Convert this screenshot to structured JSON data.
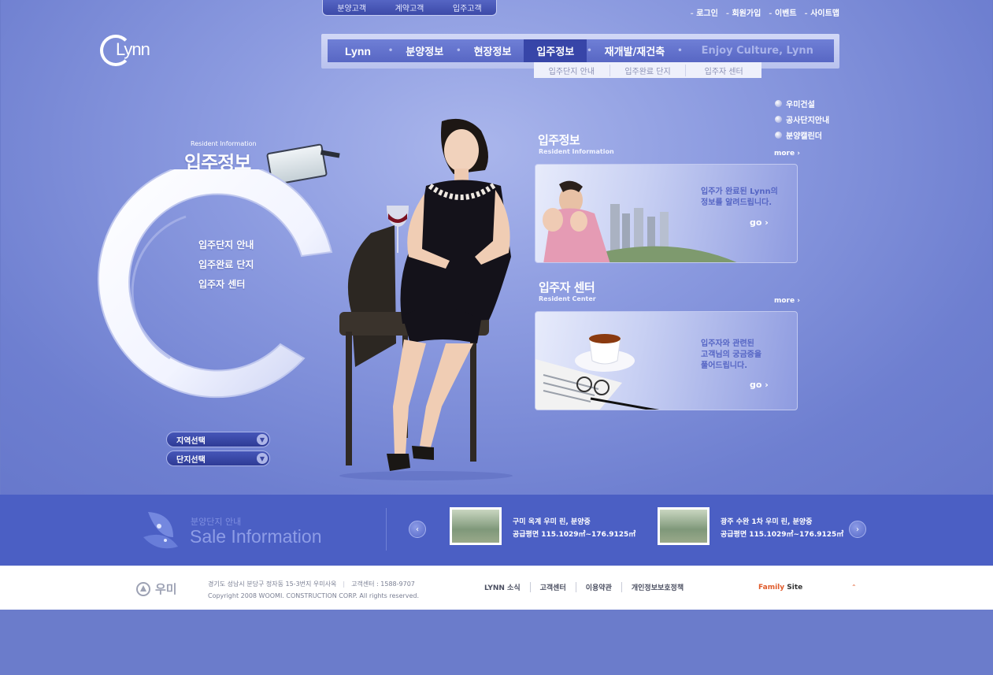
{
  "customer_tabs": [
    "분양고객",
    "계약고객",
    "입주고객"
  ],
  "util_links": [
    "로그인",
    "회원가입",
    "이벤트",
    "사이트맵"
  ],
  "logo": {
    "text": "Lynn"
  },
  "gnb": {
    "items": [
      "Lynn",
      "분양정보",
      "현장정보",
      "입주정보",
      "재개발/재건축"
    ],
    "culture": "Enjoy Culture, Lynn",
    "active_index": 3
  },
  "sub_gnb": [
    "입주단지 안내",
    "입주완료 단지",
    "입주자 센터"
  ],
  "quick_links": [
    "우미건설",
    "공사단지안내",
    "분양캘린더"
  ],
  "section": {
    "title_en": "Resident Information",
    "title_ko": "입주정보",
    "menu": [
      "입주단지 안내",
      "입주완료 단지",
      "입주자 센터"
    ]
  },
  "selectors": [
    "지역선택",
    "단지선택"
  ],
  "panels": {
    "info": {
      "title": "입주정보",
      "subtitle": "Resident Information",
      "more": "more",
      "text_line1": "입주가 완료된 Lynn의",
      "text_line2": "정보를 알려드립니다.",
      "go": "go"
    },
    "center": {
      "title": "입주자 센터",
      "subtitle": "Resident Center",
      "more": "more",
      "text_line1": "입주자와 관련된",
      "text_line2": "고객님의 궁금증을",
      "text_line3": "풀어드립니다.",
      "go": "go"
    }
  },
  "sale": {
    "title_ko": "분양단지 안내",
    "title_en": "Sale Information",
    "items": [
      {
        "name": "구미 옥계 우미 린, 분양중",
        "area": "공급평면 115.1029㎡~176.9125㎡"
      },
      {
        "name": "광주 수완 1차 우미 린, 분양중",
        "area": "공급평면 115.1029㎡~176.9125㎡"
      }
    ]
  },
  "footer": {
    "logo": "우미",
    "address": "경기도 성남시 분당구 정자동 15-3번지 우미사옥",
    "center": "고객센터 : 1588-9707",
    "copyright": "Copyright 2008  WOOMI. CONSTRUCTION CORP. All rights reserved.",
    "links": [
      "LYNN 소식",
      "고객센터",
      "이용약관",
      "개인정보보호정책"
    ],
    "family_word": "Family",
    "family_site": "Site",
    "family_arrow": "⌃"
  }
}
